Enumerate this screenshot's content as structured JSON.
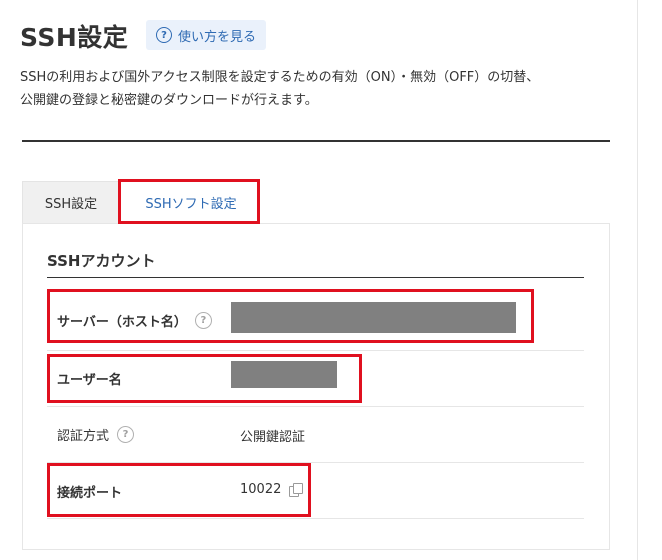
{
  "header": {
    "title": "SSH設定",
    "help_label": "使い方を見る",
    "description_line1": "SSHの利用および国外アクセス制限を設定するための有効（ON）・無効（OFF）の切替、",
    "description_line2": "公開鍵の登録と秘密鍵のダウンロードが行えます。"
  },
  "tabs": [
    {
      "label": "SSH設定",
      "active": true
    },
    {
      "label": "SSHソフト設定",
      "active": false
    }
  ],
  "account": {
    "section_title": "SSHアカウント",
    "rows": [
      {
        "label": "サーバー（ホスト名）",
        "value": "",
        "masked": true
      },
      {
        "label": "ユーザー名",
        "value": "",
        "masked": true
      },
      {
        "label": "認証方式",
        "value": "公開鍵認証"
      },
      {
        "label": "接続ポート",
        "value": "10022"
      }
    ]
  },
  "colors": {
    "accent": "#2e6ab3",
    "highlight": "#e0101f",
    "mask": "#808080"
  }
}
